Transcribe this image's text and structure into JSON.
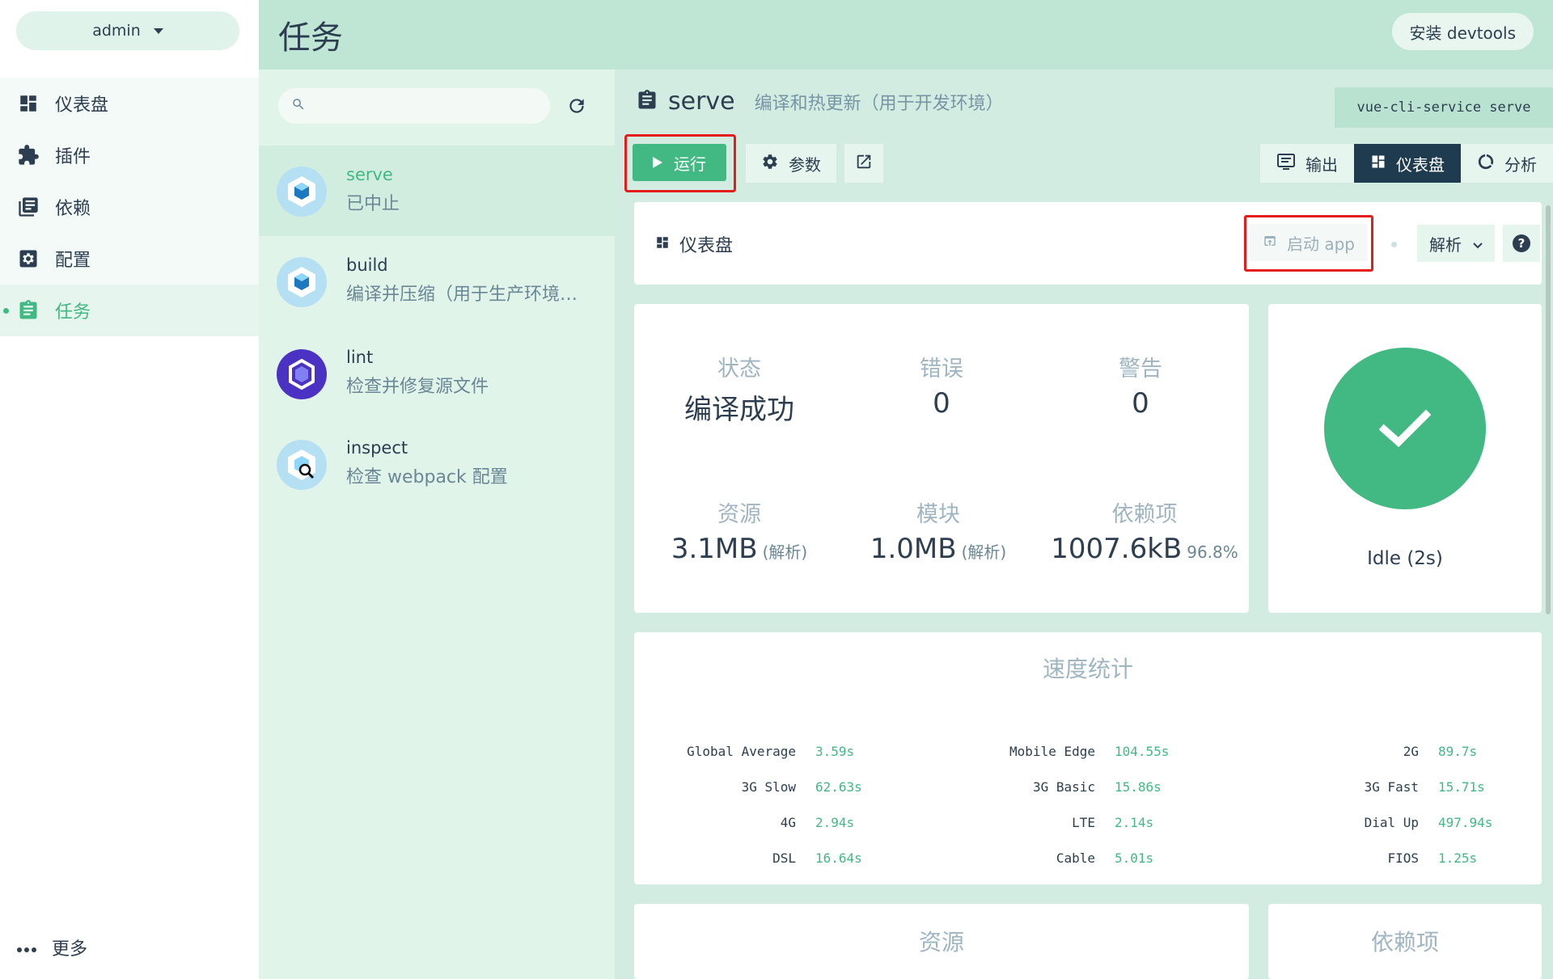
{
  "sidebar": {
    "project": "admin",
    "items": [
      {
        "label": "仪表盘"
      },
      {
        "label": "插件"
      },
      {
        "label": "依赖"
      },
      {
        "label": "配置"
      },
      {
        "label": "任务"
      }
    ],
    "more_label": "更多"
  },
  "header": {
    "title": "任务",
    "devtools_label": "安装 devtools"
  },
  "tasklist": {
    "search": {
      "value": "",
      "placeholder": ""
    },
    "tasks": [
      {
        "name": "serve",
        "desc": "已中止"
      },
      {
        "name": "build",
        "desc": "编译并压缩（用于生产环境…"
      },
      {
        "name": "lint",
        "desc": "检查并修复源文件"
      },
      {
        "name": "inspect",
        "desc": "检查 webpack 配置"
      }
    ]
  },
  "task": {
    "name": "serve",
    "desc": "编译和热更新（用于开发环境）",
    "command": "vue-cli-service serve",
    "run_label": "运行",
    "params_label": "参数",
    "tabs": [
      {
        "label": "输出"
      },
      {
        "label": "仪表盘"
      },
      {
        "label": "分析"
      }
    ]
  },
  "dashboard": {
    "title": "仪表盘",
    "launch_label": "启动 app",
    "analyze_label": "解析",
    "stats": {
      "status_label": "状态",
      "status_value": "编译成功",
      "errors_label": "错误",
      "errors_value": "0",
      "warnings_label": "警告",
      "warnings_value": "0",
      "assets_label": "资源",
      "assets_value": "3.1MB",
      "assets_note": "(解析)",
      "modules_label": "模块",
      "modules_value": "1.0MB",
      "modules_note": "(解析)",
      "deps_label": "依赖项",
      "deps_value": "1007.6kB",
      "deps_note": "96.8%"
    },
    "idle_label": "Idle (2s)",
    "speed_title": "速度统计",
    "speed": [
      {
        "label": "Global Average",
        "value": "3.59s"
      },
      {
        "label": "Mobile Edge",
        "value": "104.55s"
      },
      {
        "label": "2G",
        "value": "89.7s"
      },
      {
        "label": "3G Slow",
        "value": "62.63s"
      },
      {
        "label": "3G Basic",
        "value": "15.86s"
      },
      {
        "label": "3G Fast",
        "value": "15.71s"
      },
      {
        "label": "4G",
        "value": "2.94s"
      },
      {
        "label": "LTE",
        "value": "2.14s"
      },
      {
        "label": "Dial Up",
        "value": "497.94s"
      },
      {
        "label": "DSL",
        "value": "16.64s"
      },
      {
        "label": "Cable",
        "value": "5.01s"
      },
      {
        "label": "FIOS",
        "value": "1.25s"
      }
    ],
    "assets_section_title": "资源",
    "deps_section_title": "依赖项"
  },
  "colors": {
    "accent": "#42b983",
    "dark": "#2c3e50",
    "header_bg": "#bfe5d4",
    "highlight_border": "#e41c1c"
  }
}
